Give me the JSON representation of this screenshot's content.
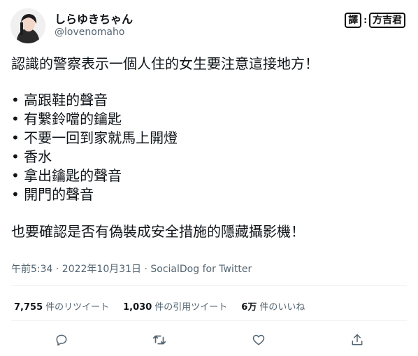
{
  "user": {
    "display_name": "しらゆきちゃん",
    "handle": "@lovenomaho"
  },
  "credit": {
    "label_a": "譯",
    "separator": ":",
    "label_b": "方吉君"
  },
  "tweet": {
    "line_intro": "認識的警察表示一個人住的女生要注意這接地方！",
    "list_items": [
      "高跟鞋的聲音",
      "有繫鈴噹的鑰匙",
      "不要一回到家就馬上開燈",
      "香水",
      "拿出鑰匙的聲音",
      "開門的聲音"
    ],
    "line_outro": "也要確認是否有偽裝成安全措施的隱藏攝影機！"
  },
  "meta": {
    "timestamp": "午前5:34 · 2022年10月31日 · SocialDog for Twitter"
  },
  "stats": {
    "retweets_count": "7,755",
    "retweets_label": "件のリツイート",
    "quotes_count": "1,030",
    "quotes_label": "件の引用ツイート",
    "likes_count": "6万",
    "likes_label": "件のいいね"
  },
  "actions": {
    "reply_icon": "reply-icon",
    "retweet_icon": "retweet-icon",
    "like_icon": "heart-icon",
    "share_icon": "share-icon"
  }
}
